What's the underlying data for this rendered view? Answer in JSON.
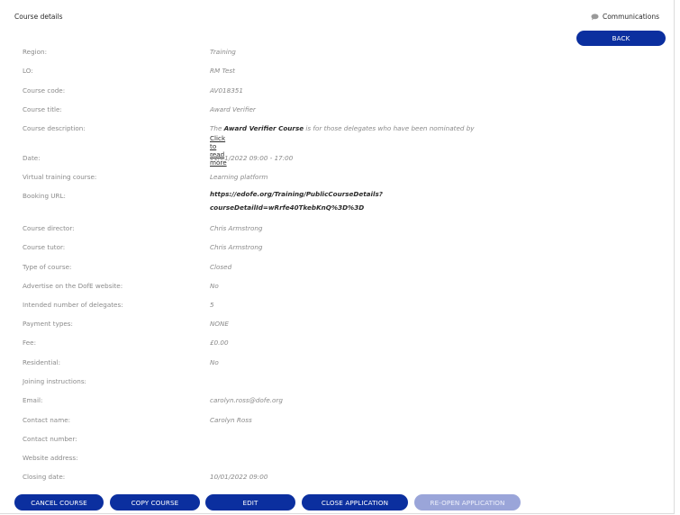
{
  "panel": {
    "title": "Course details",
    "communications_label": "Communications",
    "back_label": "BACK"
  },
  "details": [
    {
      "label": "Region:",
      "value": "Training"
    },
    {
      "label": "LO:",
      "value": "RM Test"
    },
    {
      "label": "Course code:",
      "value": "AV018351"
    },
    {
      "label": "Course title:",
      "value": "Award Verifier"
    },
    {
      "label": "Course description:",
      "value_prefix": "The ",
      "value_bold": "Award Verifier Course",
      "value_suffix": " is for those delegates who have been nominated by",
      "read_more": "Click to read more"
    },
    {
      "label": "Date:",
      "value": "11/01/2022 09:00 - 17:00"
    },
    {
      "label": "Virtual training course:",
      "value": "Learning platform"
    },
    {
      "label": "Booking URL:",
      "value_line1": "https://edofe.org/Training/PublicCourseDetails?",
      "value_line2": "courseDetailId=wRrfe40TkebKnQ%3D%3D"
    },
    {
      "label": "Course director:",
      "value": "Chris Armstrong"
    },
    {
      "label": "Course tutor:",
      "value": "Chris Armstrong"
    },
    {
      "label": "Type of course:",
      "value": "Closed"
    },
    {
      "label": "Advertise on the DofE website:",
      "value": "No"
    },
    {
      "label": "Intended number of delegates:",
      "value": "5"
    },
    {
      "label": "Payment types:",
      "value": "NONE"
    },
    {
      "label": "Fee:",
      "value": "£0.00"
    },
    {
      "label": "Residential:",
      "value": "No"
    },
    {
      "label": "Joining instructions:",
      "value": ""
    },
    {
      "label": "Email:",
      "value": "carolyn.ross@dofe.org"
    },
    {
      "label": "Contact name:",
      "value": "Carolyn Ross"
    },
    {
      "label": "Contact number:",
      "value": ""
    },
    {
      "label": "Website address:",
      "value": ""
    },
    {
      "label": "Closing date:",
      "value": "10/01/2022 09:00"
    }
  ],
  "actions": {
    "cancel_course": "CANCEL COURSE",
    "copy_course": "COPY COURSE",
    "edit": "EDIT",
    "close_application": "CLOSE APPLICATION",
    "reopen_application": "RE-OPEN APPLICATION"
  },
  "colors": {
    "primary": "#0b2f9f",
    "disabled": "#9aa5d9",
    "label": "#8a8a8a",
    "text_dark": "#2b2b2b"
  },
  "icons": {
    "communications": "speech-bubble-icon"
  }
}
